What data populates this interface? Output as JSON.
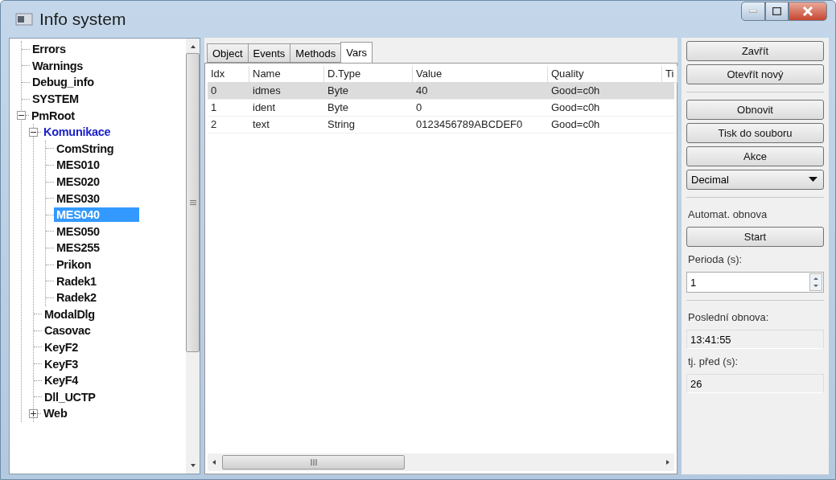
{
  "window": {
    "title": "Info system"
  },
  "tree": [
    {
      "label": "Errors",
      "selected": false,
      "highlighted": false
    },
    {
      "label": "Warnings",
      "selected": false,
      "highlighted": false
    },
    {
      "label": "Debug_info",
      "selected": false,
      "highlighted": false
    },
    {
      "label": "SYSTEM",
      "selected": false,
      "highlighted": false
    },
    {
      "label": "PmRoot",
      "selected": false,
      "highlighted": false,
      "expanded": true,
      "children": [
        {
          "label": "Komunikace",
          "selected": false,
          "highlighted": true,
          "expanded": true,
          "children": [
            {
              "label": "ComString",
              "selected": false,
              "highlighted": false
            },
            {
              "label": "MES010",
              "selected": false,
              "highlighted": false
            },
            {
              "label": "MES020",
              "selected": false,
              "highlighted": false
            },
            {
              "label": "MES030",
              "selected": false,
              "highlighted": false
            },
            {
              "label": "MES040",
              "selected": true,
              "highlighted": false
            },
            {
              "label": "MES050",
              "selected": false,
              "highlighted": false
            },
            {
              "label": "MES255",
              "selected": false,
              "highlighted": false
            },
            {
              "label": "Prikon",
              "selected": false,
              "highlighted": false
            },
            {
              "label": "Radek1",
              "selected": false,
              "highlighted": false
            },
            {
              "label": "Radek2",
              "selected": false,
              "highlighted": false
            }
          ]
        },
        {
          "label": "ModalDlg",
          "selected": false,
          "highlighted": false
        },
        {
          "label": "Casovac",
          "selected": false,
          "highlighted": false
        },
        {
          "label": "KeyF2",
          "selected": false,
          "highlighted": false
        },
        {
          "label": "KeyF3",
          "selected": false,
          "highlighted": false
        },
        {
          "label": "KeyF4",
          "selected": false,
          "highlighted": false
        },
        {
          "label": "Dll_UCTP",
          "selected": false,
          "highlighted": false
        },
        {
          "label": "Web",
          "selected": false,
          "highlighted": false,
          "expanded": false
        }
      ]
    }
  ],
  "tabs": [
    {
      "label": "Object",
      "selected": false
    },
    {
      "label": "Events",
      "selected": false
    },
    {
      "label": "Methods",
      "selected": false
    },
    {
      "label": "Vars",
      "selected": true
    }
  ],
  "table": {
    "columns": [
      "Idx",
      "Name",
      "D.Type",
      "Value",
      "Quality",
      "Ti"
    ],
    "rows": [
      {
        "selected": true,
        "cells": [
          "0",
          "idmes",
          "Byte",
          "40",
          "Good=c0h"
        ]
      },
      {
        "selected": false,
        "cells": [
          "1",
          "ident",
          "Byte",
          "0",
          "Good=c0h"
        ]
      },
      {
        "selected": false,
        "cells": [
          "2",
          "text",
          "String",
          "0123456789ABCDEF0",
          "Good=c0h"
        ]
      }
    ]
  },
  "side": {
    "buttons_top": [
      "Zavřít",
      "Otevřít nový"
    ],
    "buttons_mid": [
      "Obnovit",
      "Tisk do souboru",
      "Akce"
    ],
    "format_select": {
      "value": "Decimal"
    },
    "auto_label": "Automat. obnova",
    "start_button": "Start",
    "period_label": "Perioda (s):",
    "period_value": "1",
    "last_label": "Poslední obnova:",
    "last_value": "13:41:55",
    "ago_label": "tj. před (s):",
    "ago_value": "26"
  }
}
